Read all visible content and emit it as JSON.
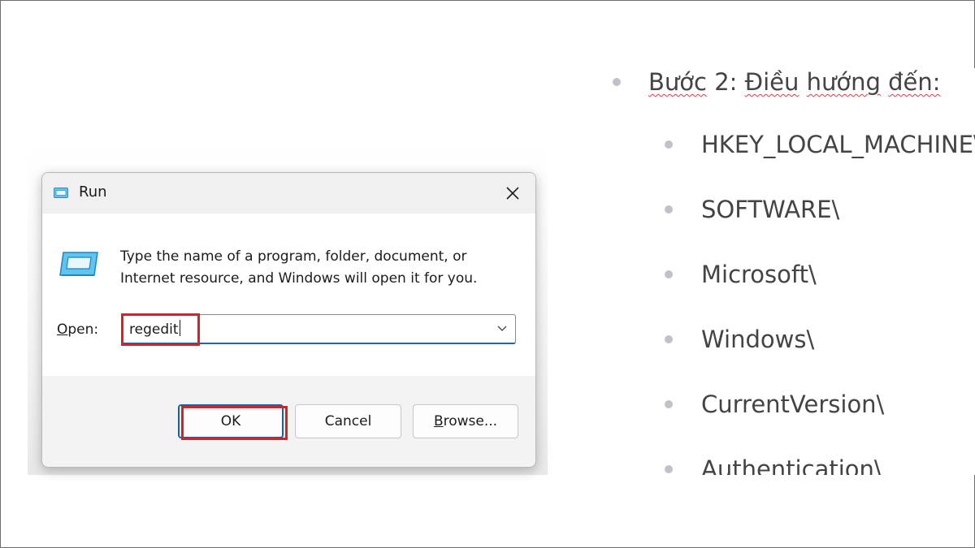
{
  "dialog": {
    "title": "Run",
    "description_line1": "Type the name of a program, folder, document, or",
    "description_line2": "Internet resource, and Windows will open it for you.",
    "open_label_underlined": "O",
    "open_label_rest": "pen:",
    "open_value": "regedit",
    "buttons": {
      "ok_label": "OK",
      "cancel_label": "Cancel",
      "browse_underlined": "B",
      "browse_rest": "rowse..."
    },
    "icons": {
      "title": "run-icon",
      "close": "close-icon",
      "main": "run-icon",
      "dropdown": "chevron-down-icon"
    }
  },
  "document": {
    "step_words": [
      "Bước",
      "2:",
      "Điều",
      "hướng",
      "đến:"
    ],
    "path_items": [
      "HKEY_LOCAL_MACHINE\\",
      "SOFTWARE\\",
      "Microsoft\\",
      "Windows\\",
      "CurrentVersion\\",
      "Authentication\\"
    ]
  },
  "colors": {
    "highlight": "#d2232a",
    "accent": "#0067c0",
    "doc_text": "#444444",
    "bullet": "#bfc3c8",
    "spellcheck": "#e23a3a"
  }
}
